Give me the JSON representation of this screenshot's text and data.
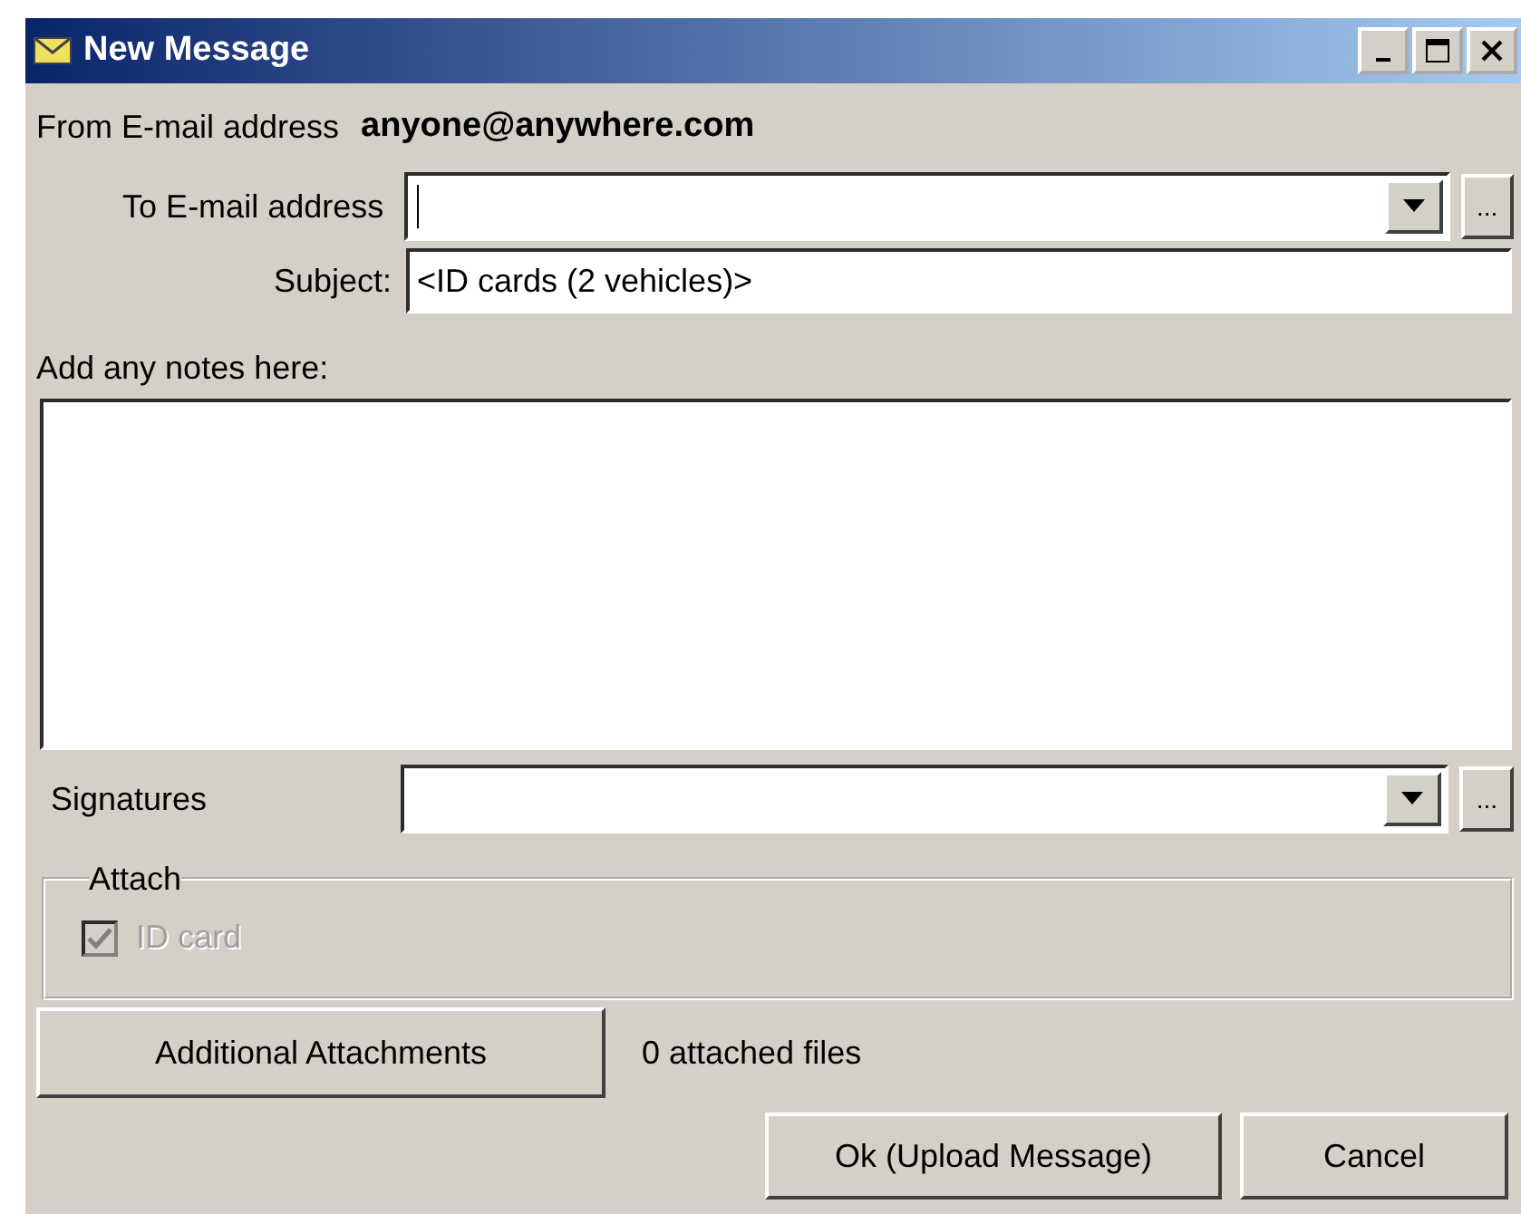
{
  "window": {
    "title": "New Message"
  },
  "from": {
    "label": "From E-mail address",
    "value": "anyone@anywhere.com"
  },
  "to": {
    "label": "To E-mail address",
    "focused": true,
    "browse": "..."
  },
  "subject": {
    "label": "Subject:",
    "value": "<ID cards (2 vehicles)>"
  },
  "notes": {
    "label": "Add any notes here:"
  },
  "signatures": {
    "label": "Signatures",
    "browse": "..."
  },
  "attach": {
    "legend": "Attach",
    "items": [
      {
        "label": "ID card",
        "checked": true,
        "disabled": true
      }
    ]
  },
  "attachments_button": "Additional Attachments",
  "attached_count": "0 attached files",
  "buttons": [
    {
      "label": "Ok (Upload Message)",
      "kind": "ok"
    },
    {
      "label": "Cancel",
      "kind": "cancel"
    }
  ]
}
